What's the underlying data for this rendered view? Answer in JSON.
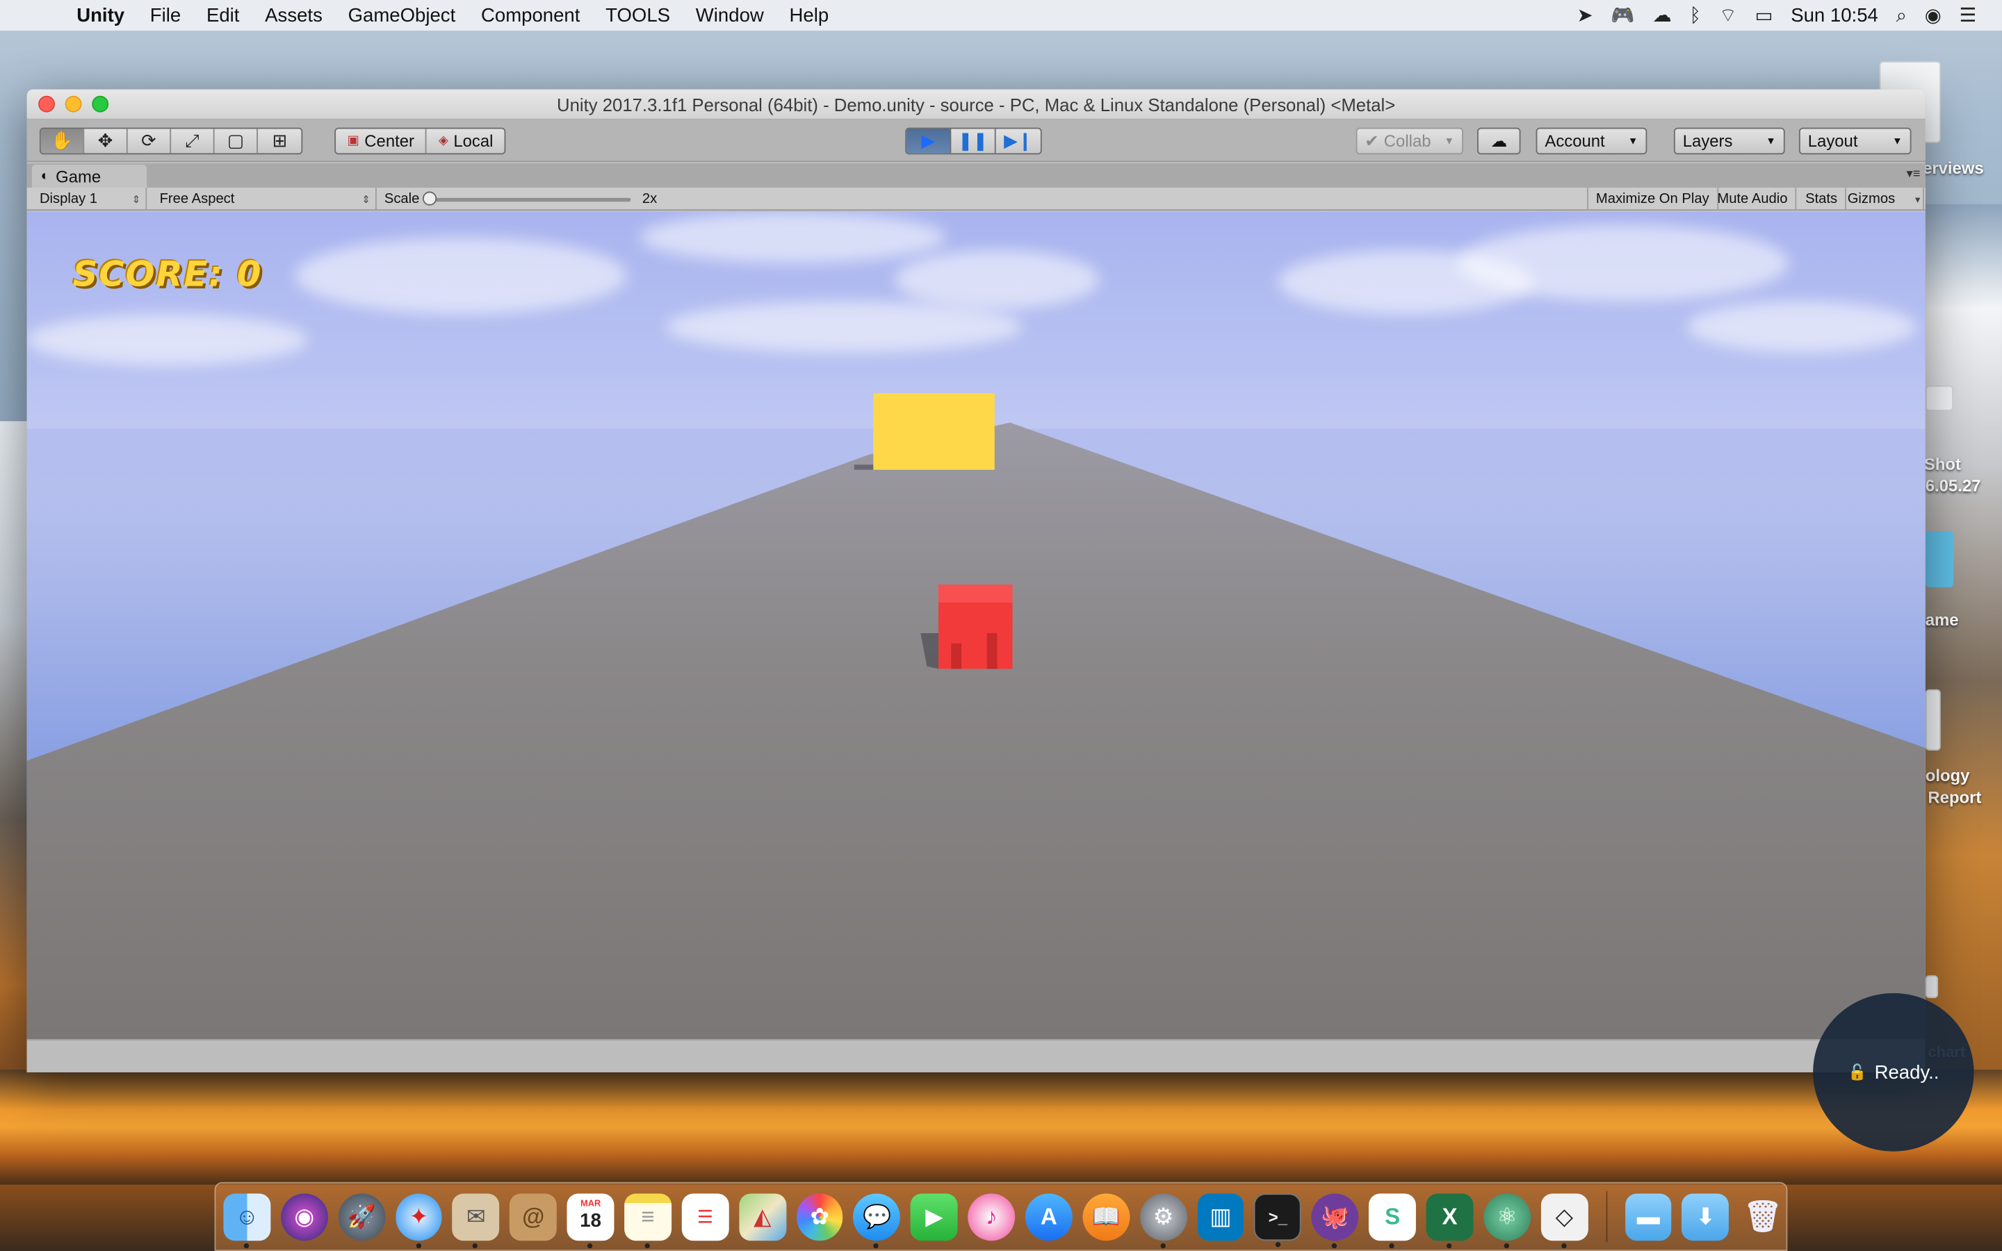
{
  "menubar": {
    "app_name": "Unity",
    "items": [
      "File",
      "Edit",
      "Assets",
      "GameObject",
      "Component",
      "TOOLS",
      "Window",
      "Help"
    ],
    "clock": "Sun 10:54"
  },
  "window": {
    "title": "Unity 2017.3.1f1 Personal (64bit) - Demo.unity - source - PC, Mac & Linux Standalone (Personal) <Metal>"
  },
  "toolbar": {
    "pivot_center": "Center",
    "pivot_local": "Local",
    "collab": "Collab",
    "account": "Account",
    "layers": "Layers",
    "layout": "Layout"
  },
  "game_tab": {
    "label": "Game",
    "display": "Display 1",
    "aspect": "Free Aspect",
    "scale_label": "Scale",
    "scale_value": "2x",
    "maximize_on_play": "Maximize On Play",
    "mute_audio": "Mute Audio",
    "stats": "Stats",
    "gizmos": "Gizmos"
  },
  "game": {
    "score_text": "SCORE: 0",
    "colors": {
      "obstacle": "#ffd84a",
      "player": "#f23a3a",
      "road": "#7c7979",
      "sky": "#aeb8ef"
    }
  },
  "desktop": {
    "labels": [
      "erviews",
      "Shot",
      "6.05.27",
      "ame",
      "ology",
      "Report",
      "chart"
    ]
  },
  "ready": {
    "text": "Ready.."
  },
  "dock": {
    "icons": [
      "finder-icon",
      "siri-icon",
      "launchpad-icon",
      "safari-icon",
      "mail-icon",
      "contacts-icon",
      "calendar-icon",
      "notes-icon",
      "reminders-icon",
      "maps-icon",
      "photos-icon",
      "messages-icon",
      "facetime-icon",
      "itunes-icon",
      "app-store-icon",
      "ibooks-icon",
      "system-preferences-icon",
      "trello-icon",
      "terminal-icon",
      "github-icon",
      "slack-icon",
      "excel-icon",
      "atom-icon",
      "unity-icon",
      "folder-icon",
      "downloads-folder-icon",
      "trash-icon"
    ],
    "calendar_month": "MAR",
    "calendar_day": "18"
  }
}
